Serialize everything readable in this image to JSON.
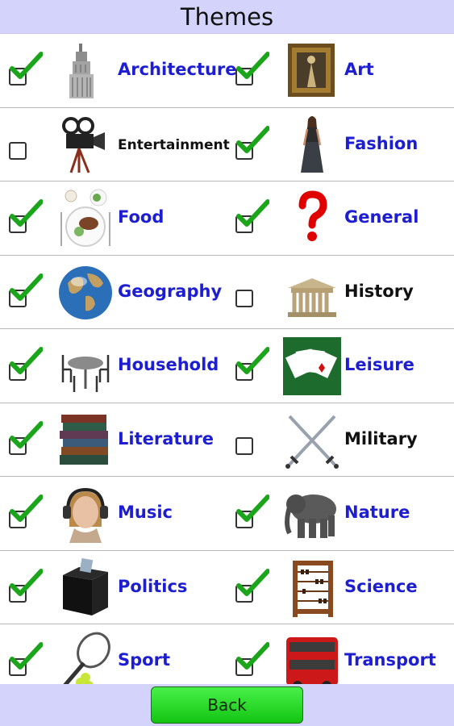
{
  "header": {
    "title": "Themes"
  },
  "themes": [
    {
      "label": "Architecture",
      "checked": true,
      "icon": "skyscraper-icon"
    },
    {
      "label": "Art",
      "checked": true,
      "icon": "framed-painting-icon"
    },
    {
      "label": "Entertainment",
      "checked": false,
      "icon": "movie-camera-icon"
    },
    {
      "label": "Fashion",
      "checked": true,
      "icon": "fashion-model-icon"
    },
    {
      "label": "Food",
      "checked": true,
      "icon": "food-plate-icon"
    },
    {
      "label": "General",
      "checked": true,
      "icon": "question-mark-icon"
    },
    {
      "label": "Geography",
      "checked": true,
      "icon": "globe-icon"
    },
    {
      "label": "History",
      "checked": false,
      "icon": "temple-icon"
    },
    {
      "label": "Household",
      "checked": true,
      "icon": "table-chairs-icon"
    },
    {
      "label": "Leisure",
      "checked": true,
      "icon": "playing-cards-icon"
    },
    {
      "label": "Literature",
      "checked": true,
      "icon": "books-icon"
    },
    {
      "label": "Military",
      "checked": false,
      "icon": "crossed-swords-icon"
    },
    {
      "label": "Music",
      "checked": true,
      "icon": "headphones-girl-icon"
    },
    {
      "label": "Nature",
      "checked": true,
      "icon": "elephant-icon"
    },
    {
      "label": "Politics",
      "checked": true,
      "icon": "ballot-box-icon"
    },
    {
      "label": "Science",
      "checked": true,
      "icon": "abacus-icon"
    },
    {
      "label": "Sport",
      "checked": true,
      "icon": "tennis-racket-icon"
    },
    {
      "label": "Transport",
      "checked": true,
      "icon": "double-decker-bus-icon"
    }
  ],
  "footer": {
    "back_label": "Back"
  },
  "colors": {
    "header_bg": "#d3d3fb",
    "label_on": "#1d1dd2",
    "check_green": "#1aa51a",
    "button_green": "#2fd82f"
  }
}
